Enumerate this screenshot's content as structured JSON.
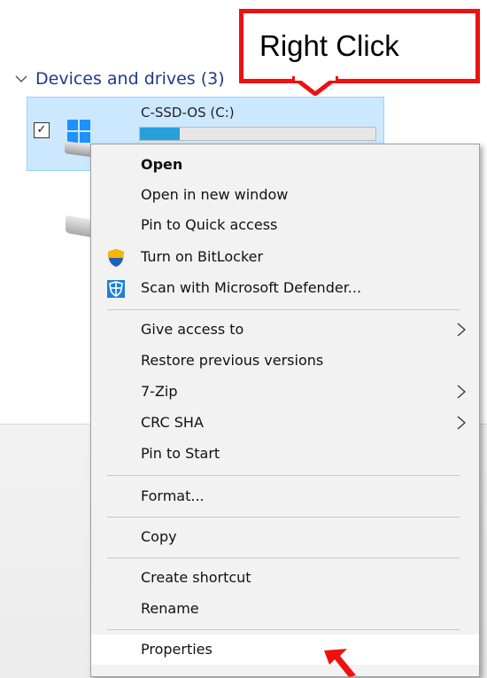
{
  "section": {
    "title": "Devices and drives (3)",
    "chevron_icon": "chevron-down-icon"
  },
  "drive": {
    "name": "C-SSD-OS (C:)",
    "used_fraction": 0.17,
    "checked": true
  },
  "callout": {
    "text": "Right Click",
    "color": "#ee1111"
  },
  "menu": {
    "items": [
      {
        "label": "Open",
        "bold": true
      },
      {
        "label": "Open in new window"
      },
      {
        "label": "Pin to Quick access"
      },
      {
        "label": "Turn on BitLocker",
        "icon": "shield-icon"
      },
      {
        "label": "Scan with Microsoft Defender...",
        "icon": "defender-icon"
      },
      {
        "label": "Give access to",
        "submenu": true
      },
      {
        "label": "Restore previous versions"
      },
      {
        "label": "7-Zip",
        "submenu": true
      },
      {
        "label": "CRC SHA",
        "submenu": true
      },
      {
        "label": "Pin to Start"
      },
      {
        "label": "Format..."
      },
      {
        "label": "Copy"
      },
      {
        "label": "Create shortcut"
      },
      {
        "label": "Rename"
      },
      {
        "label": "Properties",
        "highlighted": true
      }
    ]
  },
  "colors": {
    "selection": "#cce8ff",
    "usage_fill": "#26a0da",
    "accent_text": "#1e3a8a"
  }
}
